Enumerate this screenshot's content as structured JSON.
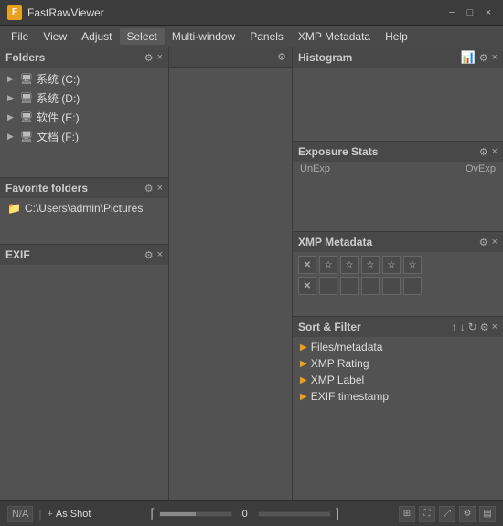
{
  "titleBar": {
    "logo": "F",
    "title": "FastRawViewer",
    "minimize": "−",
    "maximize": "□",
    "close": "×"
  },
  "menuBar": {
    "items": [
      "File",
      "View",
      "Adjust",
      "Select",
      "Multi-window",
      "Panels",
      "XMP Metadata",
      "Help"
    ]
  },
  "foldersPanel": {
    "title": "Folders",
    "folders": [
      {
        "name": "系统 (C:)"
      },
      {
        "name": "系统 (D:)"
      },
      {
        "name": "软件 (E:)"
      },
      {
        "name": "文档 (F:)"
      }
    ]
  },
  "favoriteFoldersPanel": {
    "title": "Favorite folders",
    "items": [
      "C:\\Users\\admin\\Pictures"
    ]
  },
  "exifPanel": {
    "title": "EXIF"
  },
  "middlePanel": {
    "gearLabel": "⚙"
  },
  "histogramPanel": {
    "title": "Histogram"
  },
  "exposurePanel": {
    "title": "Exposure Stats",
    "unexpLabel": "UnExp",
    "ovExpLabel": "OvExp"
  },
  "xmpPanel": {
    "title": "XMP Metadata",
    "row1": [
      "X",
      "☆",
      "☆",
      "☆",
      "☆",
      "☆"
    ],
    "row2": [
      "X",
      "",
      "",
      "",
      "",
      ""
    ]
  },
  "sortFilterPanel": {
    "title": "Sort & Filter",
    "items": [
      "Files/metadata",
      "XMP Rating",
      "XMP Label",
      "EXIF timestamp"
    ]
  },
  "statusBar": {
    "na": "N/A",
    "asShot": "As Shot",
    "number": "0",
    "plusSign": "+"
  }
}
